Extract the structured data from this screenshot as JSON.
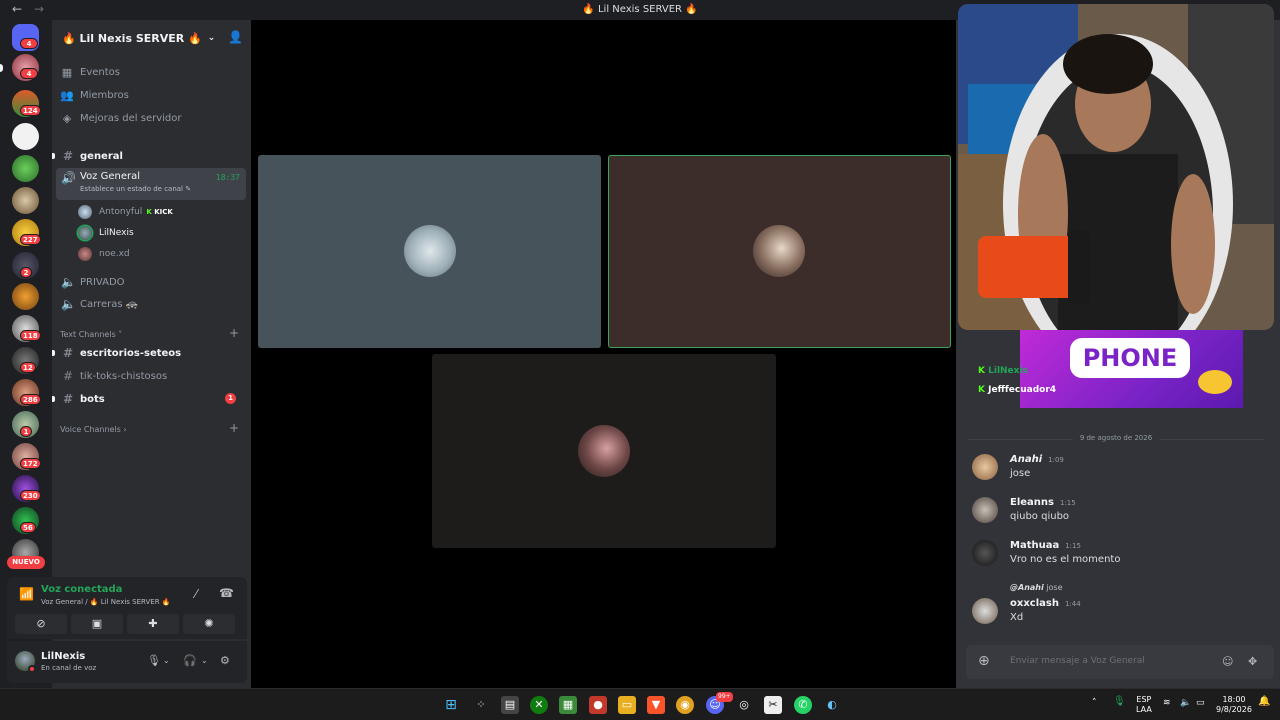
{
  "window": {
    "title": "🔥 Lil Nexis SERVER 🔥",
    "back": "←",
    "forward": "→"
  },
  "guilds": {
    "badges": [
      "4",
      "4",
      "124",
      "227",
      "2",
      "118",
      "12",
      "286",
      "1",
      "172",
      "230",
      "56"
    ],
    "new_label": "NUEVO"
  },
  "server": {
    "name": "🔥 Lil Nexis SERVER 🔥",
    "nav": [
      {
        "icon": "▦",
        "label": "Eventos"
      },
      {
        "icon": "👥",
        "label": "Miembros"
      },
      {
        "icon": "◈",
        "label": "Mejoras del servidor"
      }
    ],
    "channels": {
      "general": "general",
      "voice_general": "Voz General",
      "voice_time": "18:37",
      "voice_status": "Establece un estado de canal ✎",
      "voice_users": [
        {
          "name": "Antonyful",
          "tag_k": "K",
          "tag": "KICK"
        },
        {
          "name": "LilNexis"
        },
        {
          "name": "noe.xd"
        }
      ],
      "privado": "PRIVADO",
      "carreras": "Carreras 🚓",
      "text_category": "Text Channels ˅",
      "escritorios": "escritorios-seteos",
      "tiktoks": "tik-toks-chistosos",
      "bots": "bots",
      "bots_badge": "1",
      "voice_category": "Voice Channels ›"
    }
  },
  "voice_connected": {
    "title": "Voz conectada",
    "subtitle": "Voz General / 🔥 Lil Nexis SERVER 🔥"
  },
  "user": {
    "name": "LilNexis",
    "status": "En canal de voz"
  },
  "stream_banner": {
    "text": "PHONE",
    "line1_name": "LilNexis",
    "line2_name": "Jefffecuador4"
  },
  "chat": {
    "date": "9 de agosto de 2026",
    "messages": [
      {
        "name": "Anahi",
        "time": "1:09",
        "text": "jose",
        "color": "#f2f3f5"
      },
      {
        "name": "Eleanns",
        "time": "1:15",
        "text": "qiubo qiubo"
      },
      {
        "name": "Mathuaa",
        "time": "1:15",
        "text": "Vro no es el momento"
      },
      {
        "name": "oxxclash",
        "time": "1:44",
        "text": "Xd"
      }
    ],
    "reply": {
      "name": "@Anahi",
      "text": "jose"
    },
    "composer_placeholder": "Enviar mensaje a Voz General"
  },
  "taskbar": {
    "lang1": "ESP",
    "lang2": "LAA",
    "time": "18:00",
    "date": "9/8/2026",
    "discord_badge": "99+"
  },
  "colors": {
    "green": "#23a559",
    "red": "#f23f43",
    "kick": "#53fc18",
    "accent_purple": "#7a23c7"
  }
}
